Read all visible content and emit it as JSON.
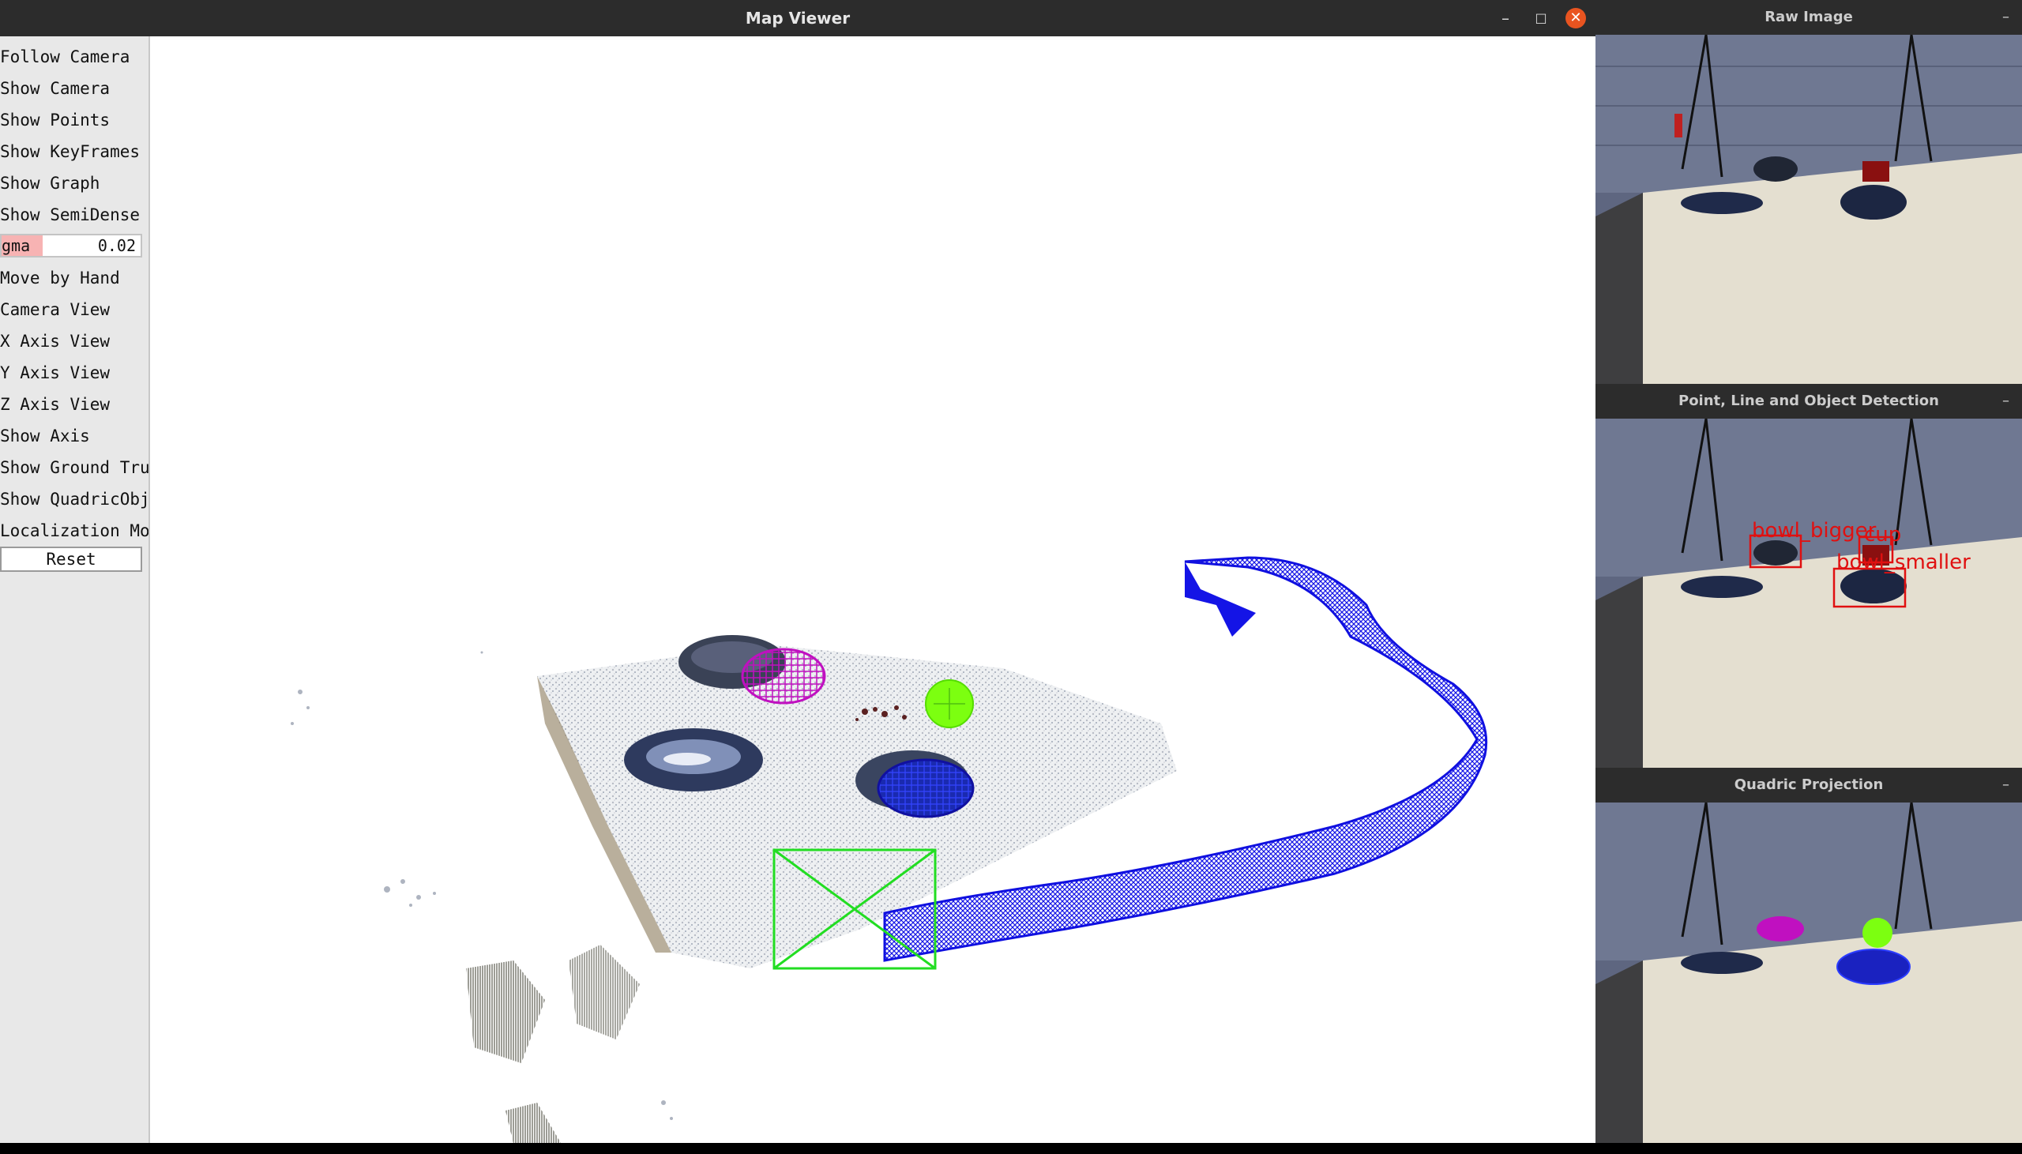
{
  "map_viewer": {
    "title": "Map Viewer",
    "controls": {
      "minimize": "–",
      "maximize": "□",
      "close": "✕"
    },
    "menu": [
      "Follow Camera",
      "Show Camera",
      "Show Points",
      "Show KeyFrames",
      "Show Graph",
      "Show SemiDense"
    ],
    "sigma": {
      "label": "gma",
      "value": "0.02"
    },
    "menu2": [
      "Move by Hand",
      "Camera View",
      "X Axis View",
      "Y Axis View",
      "Z Axis View",
      "Show Axis",
      "Show Ground Truth",
      "Show QuadricObj",
      "Localization Mode"
    ],
    "reset_label": "Reset"
  },
  "raw_image": {
    "title": "Raw Image",
    "minimize": "–"
  },
  "detection": {
    "title": "Point, Line and Object Detection",
    "minimize": "–",
    "labels": [
      "bowl_bigger",
      "cup",
      "bowl_smaller"
    ]
  },
  "projection": {
    "title": "Quadric Projection",
    "minimize": "–"
  },
  "colors": {
    "trajectory": "#1010e0",
    "camera_frame": "#22dd22",
    "magenta_quadric": "#c010c0",
    "green_quadric": "#7cff10",
    "detection_box": "#e01010",
    "sigma_fill": "#f7b3b3",
    "close_button": "#e95420"
  }
}
